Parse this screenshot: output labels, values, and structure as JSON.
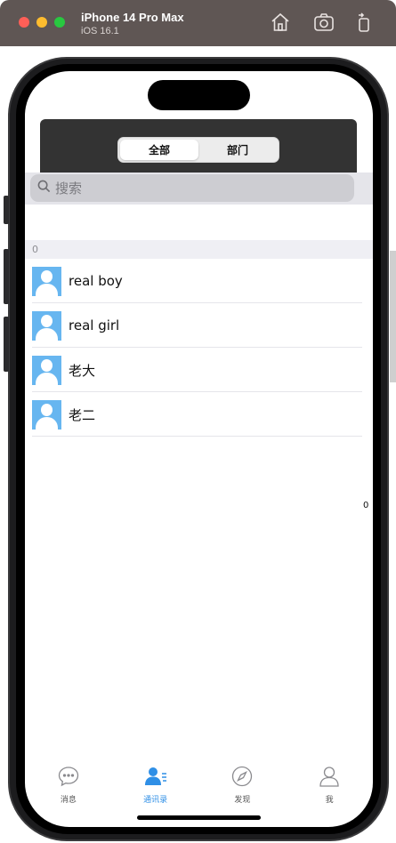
{
  "simulator": {
    "device": "iPhone 14 Pro Max",
    "os": "iOS 16.1",
    "icons": [
      "home-icon",
      "screenshot-icon",
      "rotate-icon"
    ]
  },
  "header": {
    "segments": [
      {
        "label": "全部",
        "active": true
      },
      {
        "label": "部门",
        "active": false
      }
    ]
  },
  "search": {
    "placeholder": "搜索"
  },
  "section": {
    "title": "0"
  },
  "contacts": [
    {
      "name": "real boy"
    },
    {
      "name": "real girl"
    },
    {
      "name": "老大"
    },
    {
      "name": "老二"
    }
  ],
  "index": {
    "label": "0"
  },
  "tabbar": {
    "items": [
      {
        "label": "消息",
        "icon": "message-icon",
        "active": false
      },
      {
        "label": "通讯录",
        "icon": "contacts-icon",
        "active": true
      },
      {
        "label": "发现",
        "icon": "compass-icon",
        "active": false
      },
      {
        "label": "我",
        "icon": "profile-icon",
        "active": false
      }
    ]
  },
  "colors": {
    "accent": "#2f8fe6",
    "header_bg": "#333333",
    "avatar_bg": "#67b6f0"
  }
}
